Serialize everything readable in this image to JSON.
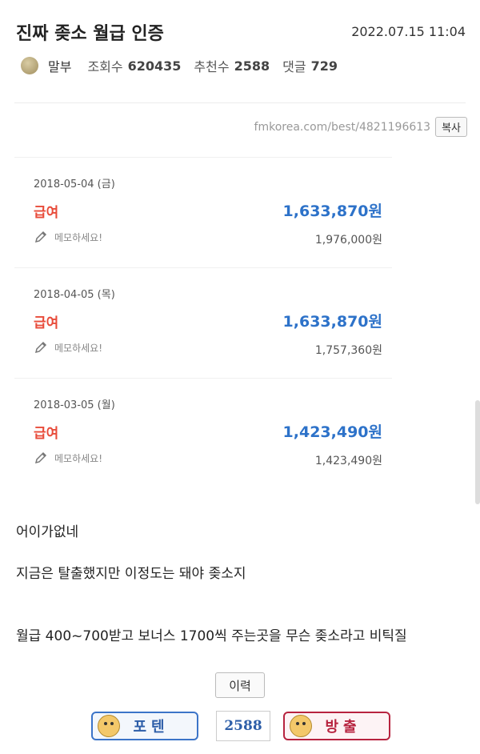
{
  "post": {
    "title": "진짜 좆소 월급 인증",
    "date": "2022.07.15 11:04",
    "author": "말부",
    "views_label": "조회수",
    "views": "620435",
    "recommend_label": "추천수",
    "recommend": "2588",
    "comments_label": "댓글",
    "comments": "729",
    "url": "fmkorea.com/best/4821196613",
    "copy_label": "복사"
  },
  "salary_cards": [
    {
      "date": "2018-05-04 (금)",
      "kind": "급여",
      "amount": "1,633,870원",
      "memo": "메모하세요!",
      "gross": "1,976,000원"
    },
    {
      "date": "2018-04-05 (목)",
      "kind": "급여",
      "amount": "1,633,870원",
      "memo": "메모하세요!",
      "gross": "1,757,360원"
    },
    {
      "date": "2018-03-05 (월)",
      "kind": "급여",
      "amount": "1,423,490원",
      "memo": "메모하세요!",
      "gross": "1,423,490원"
    }
  ],
  "body": {
    "line1": "어이가없네",
    "line2": "지금은 탈출했지만 이정도는 돼야 좆소지",
    "line3": "월급 400~700받고 보너스 1700씩 주는곳을 무슨 좆소라고 비틱질"
  },
  "actions": {
    "history_label": "이력",
    "upvote_label": "포텐",
    "vote_count": "2588",
    "downvote_label": "방출"
  },
  "colors": {
    "accent_blue": "#2d72c9",
    "salary_red": "#e84b3a",
    "downvote_red": "#b7233f"
  }
}
